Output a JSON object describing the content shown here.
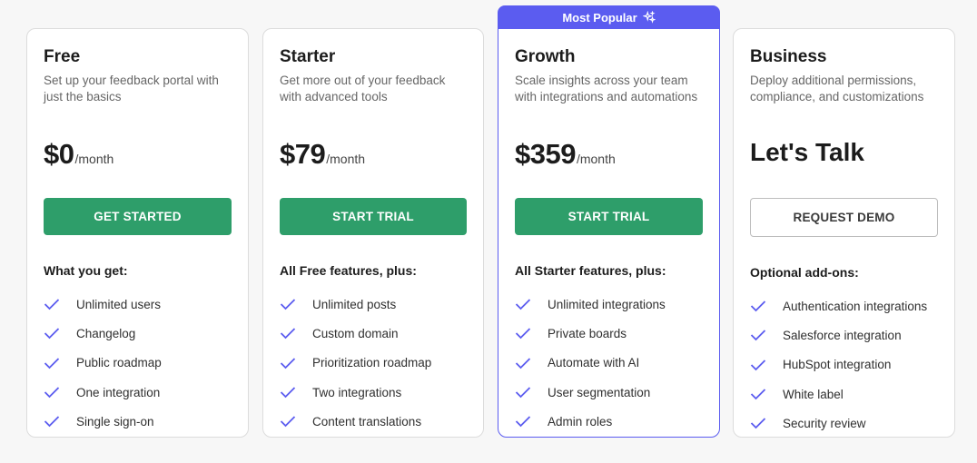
{
  "badge": {
    "label": "Most Popular",
    "icon": "sparkle-icon"
  },
  "colors": {
    "accent": "#5b5cf0",
    "cta": "#2e9e6a",
    "check": "#5b5cf0"
  },
  "plans": [
    {
      "name": "Free",
      "description": "Set up your feedback portal with just the basics",
      "price": "$0",
      "period": "/month",
      "cta": "GET STARTED",
      "features_title": "What you get:",
      "features": [
        "Unlimited users",
        "Changelog",
        "Public roadmap",
        "One integration",
        "Single sign-on"
      ]
    },
    {
      "name": "Starter",
      "description": "Get more out of your feedback with advanced tools",
      "price": "$79",
      "period": "/month",
      "cta": "START TRIAL",
      "features_title": "All Free features, plus:",
      "features": [
        "Unlimited posts",
        "Custom domain",
        "Prioritization roadmap",
        "Two integrations",
        "Content translations"
      ]
    },
    {
      "name": "Growth",
      "description": "Scale insights across your team with integrations and automations",
      "price": "$359",
      "period": "/month",
      "cta": "START TRIAL",
      "features_title": "All Starter features, plus:",
      "features": [
        "Unlimited integrations",
        "Private boards",
        "Automate with AI",
        "User segmentation",
        "Admin roles"
      ]
    },
    {
      "name": "Business",
      "description": "Deploy additional permissions, compliance, and customizations",
      "price": "Let's Talk",
      "cta": "REQUEST DEMO",
      "features_title": "Optional add-ons:",
      "features": [
        "Authentication integrations",
        "Salesforce integration",
        "HubSpot integration",
        "White label",
        "Security review"
      ]
    }
  ]
}
